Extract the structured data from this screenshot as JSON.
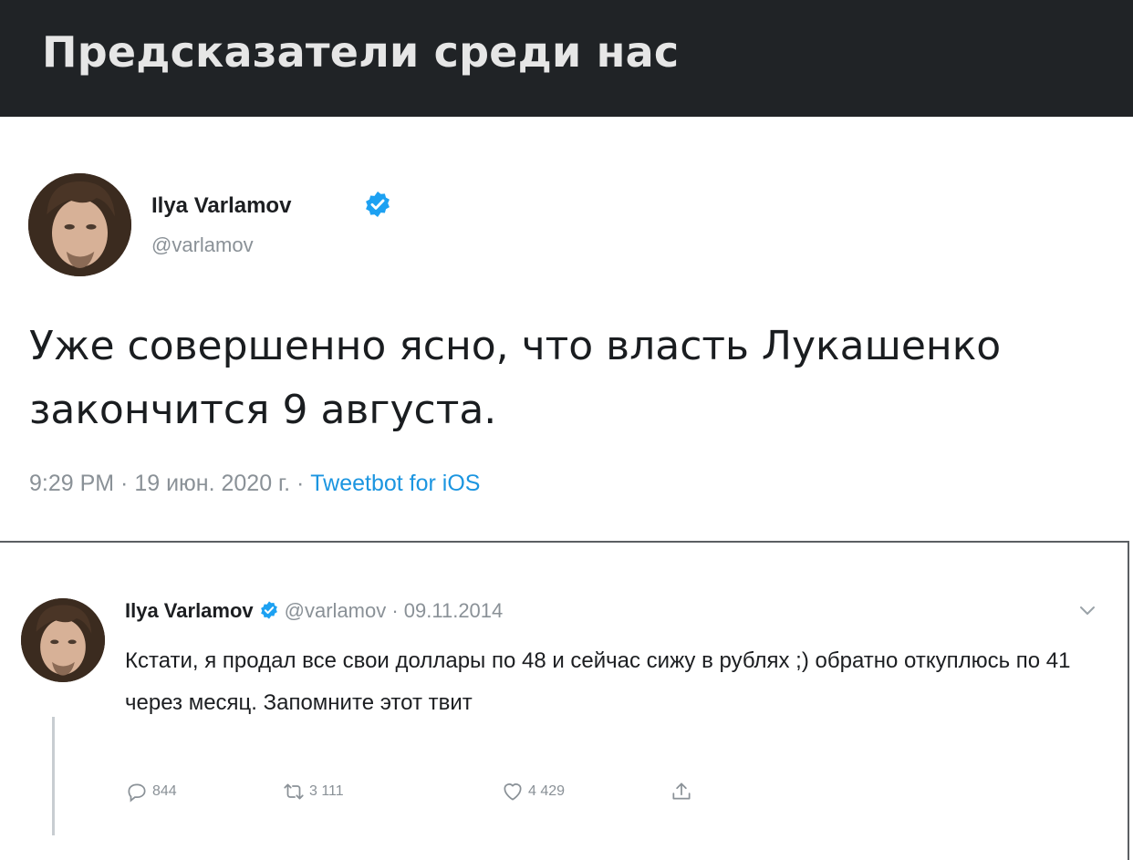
{
  "header": {
    "title": "Предсказатели среди нас"
  },
  "tweet_main": {
    "author_name": "Ilya Varlamov",
    "handle": "@varlamov",
    "text": "Уже совершенно ясно, что власть Лукашенко закончится 9 августа.",
    "meta_time": "9:29 PM · 19 июн. 2020 г. · ",
    "source": "Tweetbot for iOS"
  },
  "tweet_quoted": {
    "author_name": "Ilya Varlamov",
    "handle_date": "@varlamov · 09.11.2014",
    "text": "Кстати, я продал все свои доллары по 48 и сейчас сижу в рублях ;) обратно откуплюсь по 41 через месяц. Запомните этот твит",
    "replies": "844",
    "retweets": "3 111",
    "likes": "4 429"
  },
  "colors": {
    "header_bg": "#202326",
    "verified": "#1da1f2",
    "link": "#1b95e0",
    "muted": "#8a9197"
  }
}
